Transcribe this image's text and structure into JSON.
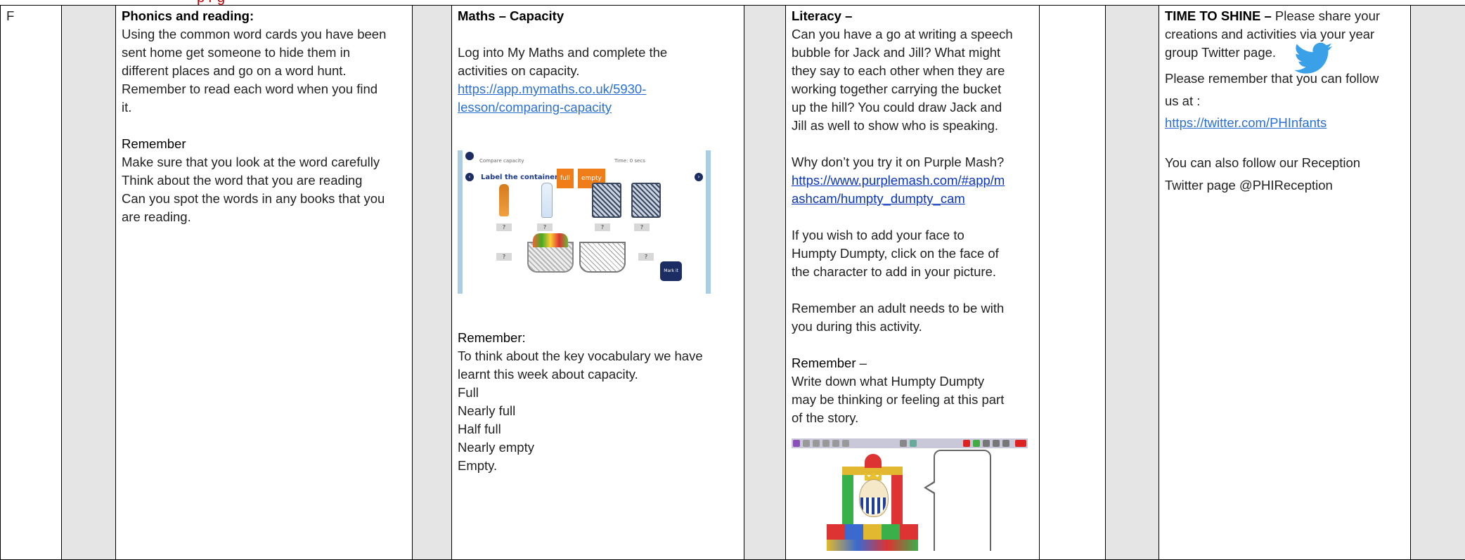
{
  "header_fragment": "p     r     g",
  "row_label": "F",
  "col_phonics": {
    "heading": "Phonics and reading:",
    "intro": [
      "Using the common word cards you have been",
      "sent home get someone to hide them in",
      "different places and go on a word hunt.",
      "Remember to read each word when you find",
      "it."
    ],
    "remember_heading": "Remember",
    "remember_lines": [
      "Make sure that you look at the word carefully",
      "Think about the word that you are reading",
      "Can you spot the words in any books that you",
      "are reading."
    ]
  },
  "col_maths": {
    "heading": "Maths – Capacity",
    "intro": [
      "Log into My Maths and complete the",
      "activities on capacity."
    ],
    "link_lines": [
      "https://app.mymaths.co.uk/5930-",
      "lesson/comparing-capacity"
    ],
    "screenshot": {
      "title": "Label the containers.",
      "tag_full": "full",
      "tag_empty": "empty",
      "top_left": "Compare capacity",
      "top_right": "Time: 0 secs",
      "q_mark": "?",
      "next": "Mark it"
    },
    "remember_heading": "Remember:",
    "remember_lines": [
      "To think about the key vocabulary we have",
      "learnt this week about capacity."
    ],
    "vocab": [
      "Full",
      "Nearly full",
      "Half full",
      "Nearly empty",
      "Empty."
    ]
  },
  "col_literacy": {
    "heading": "Literacy –",
    "intro": [
      "Can you have a go at writing a speech",
      "bubble for Jack and Jill? What might",
      "they say to each other when they are",
      "working together carrying the bucket",
      "up the hill? You could draw Jack and",
      "Jill as well to show who is speaking."
    ],
    "purple_question": "Why don’t you try it on Purple Mash?",
    "purple_link_lines": [
      "https://www.purplemash.com/#app/m",
      "ashcam/humpty_dumpty_cam"
    ],
    "face_lines": [
      "If you wish to add your face to",
      "Humpty Dumpty, click on the face of",
      "the character to add in your picture."
    ],
    "adult_lines": [
      "Remember an adult needs to be with",
      "you during this activity."
    ],
    "remember_heading": "Remember",
    "remember_dash": " –",
    "remember_lines": [
      "Write down what Humpty Dumpty",
      "may be thinking or feeling at this part",
      "of the story."
    ]
  },
  "col_shine": {
    "heading": "TIME TO SHINE –",
    "heading_rest": " Please share your",
    "intro": [
      "creations and activities via your year",
      "group Twitter page."
    ],
    "follow_lines": [
      "Please remember that you can  follow",
      "us at :"
    ],
    "twitter_link": "https://twitter.com/PHInfants",
    "reception_lines": [
      "You can also follow our Reception",
      "Twitter page @PHIReception"
    ]
  },
  "icons": {
    "twitter": "twitter-bird-icon"
  },
  "colors": {
    "link": "#2a6fd4",
    "link_dark": "#0b35b8",
    "grey_column": "#e5e5e5",
    "header_red": "#c00000",
    "twitter_blue": "#3aa0e8"
  }
}
